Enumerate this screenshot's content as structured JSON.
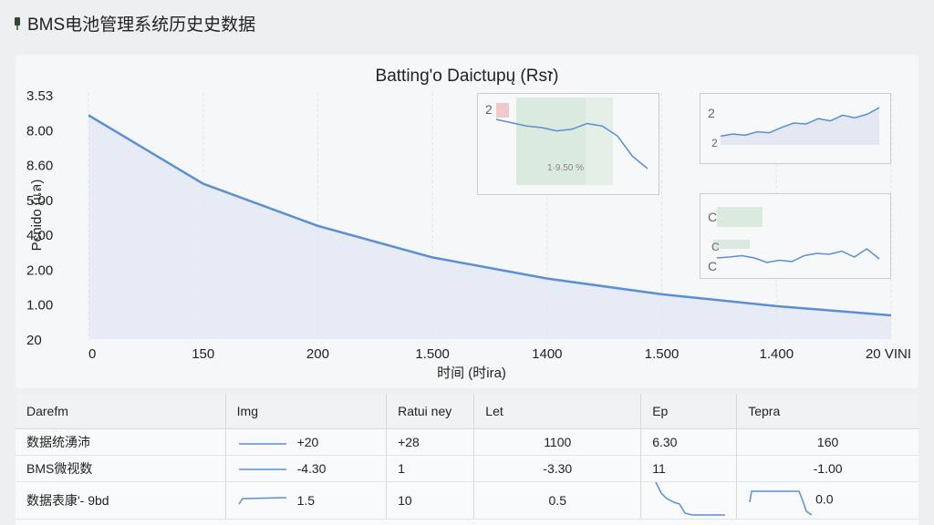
{
  "app": {
    "title": "BMS电池管理系统历史史数据",
    "icon": "battery-plug-icon"
  },
  "chart_data": {
    "type": "area",
    "title": "Batting'o Daictupų (Rsז)",
    "xlabel": "时间 (时ira)",
    "ylabel": "Pєnido (ıเล)",
    "x_tick_labels": [
      "0",
      "150",
      "200",
      "1.500",
      "1400",
      "1.500",
      "1.400",
      "20 VINI"
    ],
    "y_tick_labels": [
      "3.53",
      "8.00",
      "8.60",
      "5.00",
      "4.00",
      "2.00",
      "1.00",
      "20"
    ],
    "x": [
      0,
      1,
      2,
      3,
      4,
      5,
      6,
      7
    ],
    "y": [
      8.5,
      5.9,
      4.3,
      3.1,
      2.3,
      1.7,
      1.25,
      0.9
    ],
    "grid": true,
    "color": "#5b8fd4",
    "fill": "#dfe6f3"
  },
  "insets": [
    {
      "type": "line",
      "label": "2",
      "center_label": "1·9.50 %",
      "values": [
        0.8,
        0.76,
        0.72,
        0.7,
        0.66,
        0.68,
        0.75,
        0.72,
        0.6,
        0.35,
        0.2
      ]
    },
    {
      "type": "line",
      "label": "2",
      "label2": "2",
      "values": [
        0.2,
        0.25,
        0.22,
        0.3,
        0.28,
        0.4,
        0.5,
        0.48,
        0.6,
        0.55,
        0.68,
        0.62,
        0.7,
        0.85
      ]
    },
    {
      "type": "line",
      "label": "C",
      "label2": "C",
      "label3": "C",
      "values": [
        0.4,
        0.42,
        0.45,
        0.4,
        0.3,
        0.35,
        0.32,
        0.45,
        0.5,
        0.48,
        0.55,
        0.42,
        0.6,
        0.38
      ]
    }
  ],
  "table": {
    "headers": [
      "Darefm",
      "Img",
      "Ratui ney",
      "Let",
      "Ep",
      "Tepra"
    ],
    "rows": [
      {
        "name": "数据统湧沛",
        "img": "+20",
        "rat": "+28",
        "let": "1100",
        "ep": "6.30",
        "tepra": "160"
      },
      {
        "name": "BMS微视数",
        "img": "-4.30",
        "rat": "1",
        "let": "-3.30",
        "ep": "11",
        "tepra": "-1.00"
      },
      {
        "name": "数据表康'- 9bd",
        "img": "1.5",
        "rat": "10",
        "let": "0.5",
        "ep": "",
        "tepra": "0.0"
      }
    ]
  }
}
